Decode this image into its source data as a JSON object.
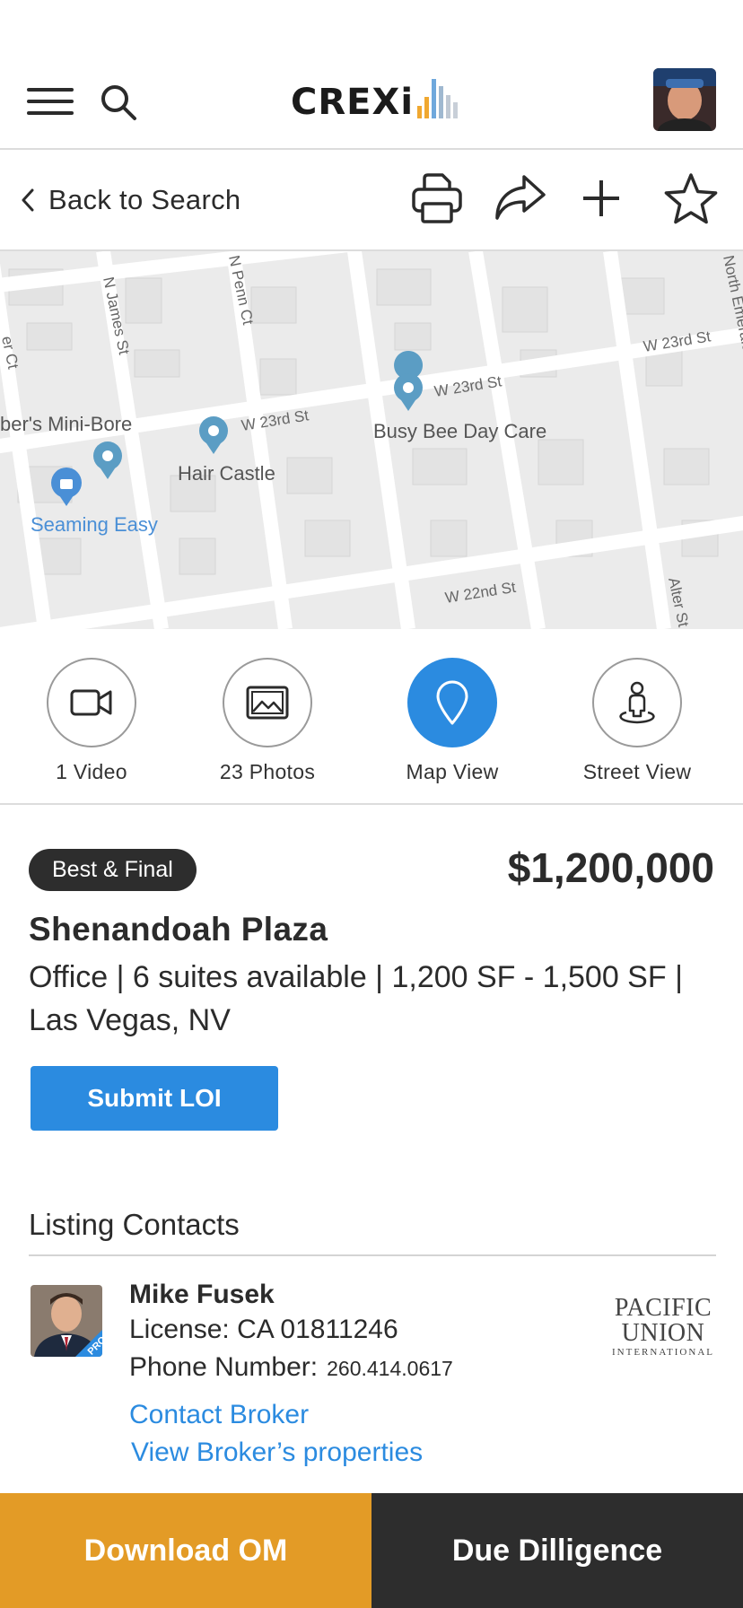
{
  "header": {
    "logo_text": "CREXi",
    "menu_icon": "hamburger-icon",
    "search_icon": "search-icon",
    "avatar": "user-avatar"
  },
  "toolbar": {
    "back_label": "Back to Search",
    "icons": [
      "printer-icon",
      "share-icon",
      "plus-icon",
      "star-icon"
    ]
  },
  "map": {
    "streets": [
      "N James St",
      "N Penn Ct",
      "W 23rd St",
      "W 23rd St",
      "W 23rd St",
      "W 22nd St",
      "North Emerald",
      "Alter St",
      "er Ct"
    ],
    "places": [
      {
        "label": "ber's Mini-Bore"
      },
      {
        "label": "Hair Castle"
      },
      {
        "label": "Busy Bee Day Care"
      },
      {
        "label": "Seaming Easy"
      }
    ]
  },
  "media": [
    {
      "label": "1 Video",
      "icon": "video-camera-icon",
      "active": false
    },
    {
      "label": "23 Photos",
      "icon": "photo-icon",
      "active": false
    },
    {
      "label": "Map View",
      "icon": "map-pin-icon",
      "active": true
    },
    {
      "label": "Street View",
      "icon": "street-view-icon",
      "active": false
    }
  ],
  "listing": {
    "badge": "Best & Final",
    "price": "$1,200,000",
    "title": "Shenandoah Plaza",
    "details": "Office | 6 suites available | 1,200 SF - 1,500 SF | Las Vegas, NV",
    "submit_label": "Submit LOI"
  },
  "contacts": {
    "heading": "Listing Contacts",
    "broker": {
      "name": "Mike Fusek",
      "license": "License: CA 01811246",
      "phone_label": "Phone Number:",
      "phone": "260.414.0617",
      "badge": "PRO",
      "contact_link": "Contact Broker",
      "properties_link": "View Broker’s properties"
    },
    "firm_logo": {
      "line1": "PACIFIC",
      "line2": "UNION",
      "line3": "INTERNATIONAL"
    }
  },
  "bottom_bar": {
    "download_label": "Download OM",
    "due_label": "Due Dilligence"
  },
  "colors": {
    "accent_blue": "#2b8be0",
    "download_orange": "#e39b26",
    "dark": "#2d2d2d"
  }
}
